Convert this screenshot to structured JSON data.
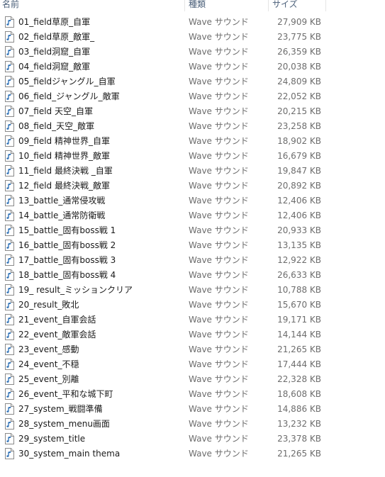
{
  "columns": {
    "name": "名前",
    "type": "種類",
    "size": "サイズ"
  },
  "icon": "audio-file-icon",
  "files": [
    {
      "name": "01_field草原_自軍",
      "type": "Wave サウンド",
      "size": "27,909 KB"
    },
    {
      "name": "02_field草原_敵軍_",
      "type": "Wave サウンド",
      "size": "23,775 KB"
    },
    {
      "name": "03_field洞窟_自軍",
      "type": "Wave サウンド",
      "size": "26,359 KB"
    },
    {
      "name": "04_field洞窟_敵軍",
      "type": "Wave サウンド",
      "size": "20,038 KB"
    },
    {
      "name": "05_fieldジャングル_自軍",
      "type": "Wave サウンド",
      "size": "24,809 KB"
    },
    {
      "name": "06_field_ジャングル_敵軍",
      "type": "Wave サウンド",
      "size": "22,052 KB"
    },
    {
      "name": "07_field 天空_自軍",
      "type": "Wave サウンド",
      "size": "20,215 KB"
    },
    {
      "name": "08_field_天空_敵軍",
      "type": "Wave サウンド",
      "size": "23,258 KB"
    },
    {
      "name": "09_field 精神世界_自軍",
      "type": "Wave サウンド",
      "size": "18,902 KB"
    },
    {
      "name": "10_field 精神世界_敵軍",
      "type": "Wave サウンド",
      "size": "16,679 KB"
    },
    {
      "name": "11_field 最終決戦 _自軍",
      "type": "Wave サウンド",
      "size": "19,847 KB"
    },
    {
      "name": "12_field 最終決戦_敵軍",
      "type": "Wave サウンド",
      "size": "20,892 KB"
    },
    {
      "name": "13_battle_通常侵攻戦",
      "type": "Wave サウンド",
      "size": "12,406 KB"
    },
    {
      "name": "14_battle_通常防衛戦",
      "type": "Wave サウンド",
      "size": "12,406 KB"
    },
    {
      "name": "15_battle_固有boss戦 1",
      "type": "Wave サウンド",
      "size": "20,933 KB"
    },
    {
      "name": "16_battle_固有boss戦 2",
      "type": "Wave サウンド",
      "size": "13,135 KB"
    },
    {
      "name": "17_battle_固有boss戦 3",
      "type": "Wave サウンド",
      "size": "12,922 KB"
    },
    {
      "name": "18_battle_固有boss戦 4",
      "type": "Wave サウンド",
      "size": "26,633 KB"
    },
    {
      "name": "19_ result_ミッションクリア",
      "type": "Wave サウンド",
      "size": "10,788 KB"
    },
    {
      "name": "20_result_敗北",
      "type": "Wave サウンド",
      "size": "15,670 KB"
    },
    {
      "name": "21_event_自軍会話",
      "type": "Wave サウンド",
      "size": "19,171 KB"
    },
    {
      "name": "22_event_敵軍会話",
      "type": "Wave サウンド",
      "size": "14,144 KB"
    },
    {
      "name": "23_event_感動",
      "type": "Wave サウンド",
      "size": "21,265 KB"
    },
    {
      "name": "24_event_不穏",
      "type": "Wave サウンド",
      "size": "17,444 KB"
    },
    {
      "name": "25_event_別離",
      "type": "Wave サウンド",
      "size": "22,328 KB"
    },
    {
      "name": "26_event_平和な城下町",
      "type": "Wave サウンド",
      "size": "18,608 KB"
    },
    {
      "name": "27_system_戦闘準備",
      "type": "Wave サウンド",
      "size": "14,886 KB"
    },
    {
      "name": "28_system_menu画面",
      "type": "Wave サウンド",
      "size": "13,232 KB"
    },
    {
      "name": "29_system_title",
      "type": "Wave サウンド",
      "size": "23,378 KB"
    },
    {
      "name": "30_system_main thema",
      "type": "Wave サウンド",
      "size": "21,265 KB"
    }
  ]
}
